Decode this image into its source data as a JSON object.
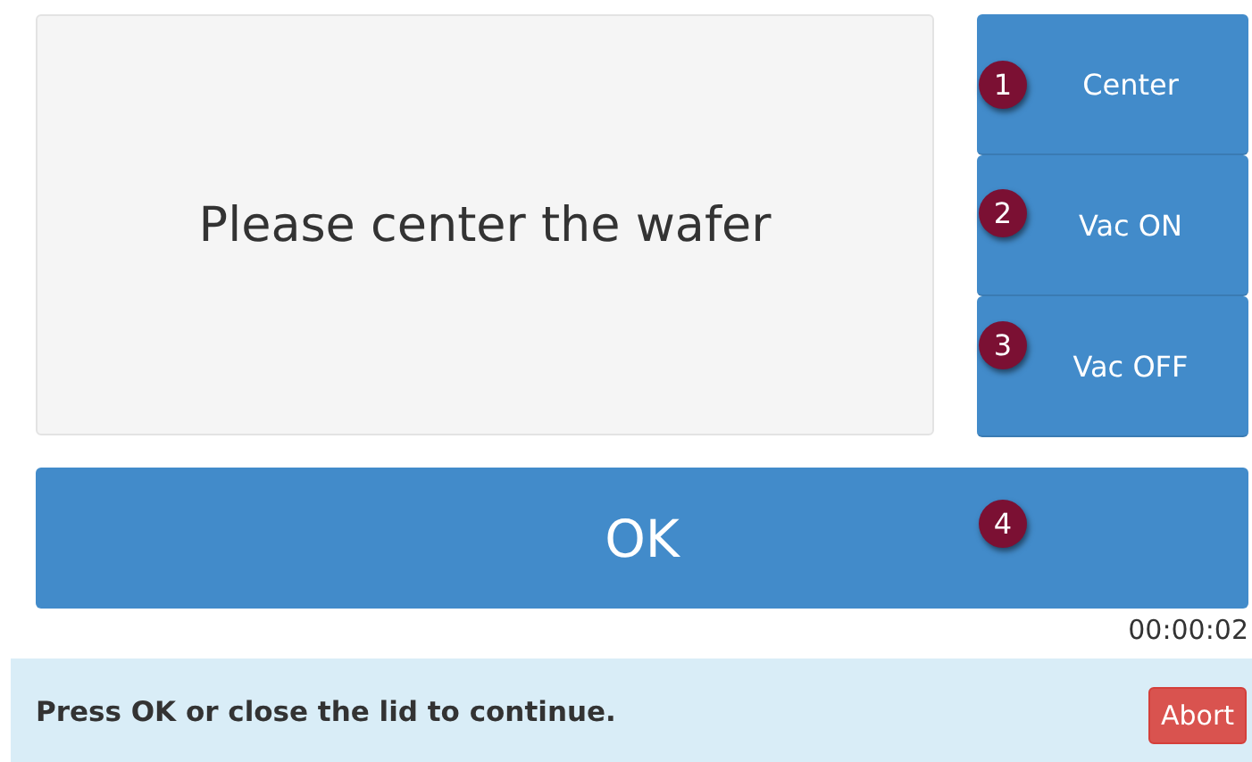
{
  "message": "Please center the wafer",
  "side_buttons": [
    {
      "badge": "1",
      "label": "Center"
    },
    {
      "badge": "2",
      "label": "Vac ON"
    },
    {
      "badge": "3",
      "label": "Vac OFF"
    }
  ],
  "ok_button": {
    "badge": "4",
    "label": "OK"
  },
  "timer": "00:00:02",
  "alert": {
    "text": "Press OK or close the lid to continue.",
    "abort_label": "Abort"
  }
}
